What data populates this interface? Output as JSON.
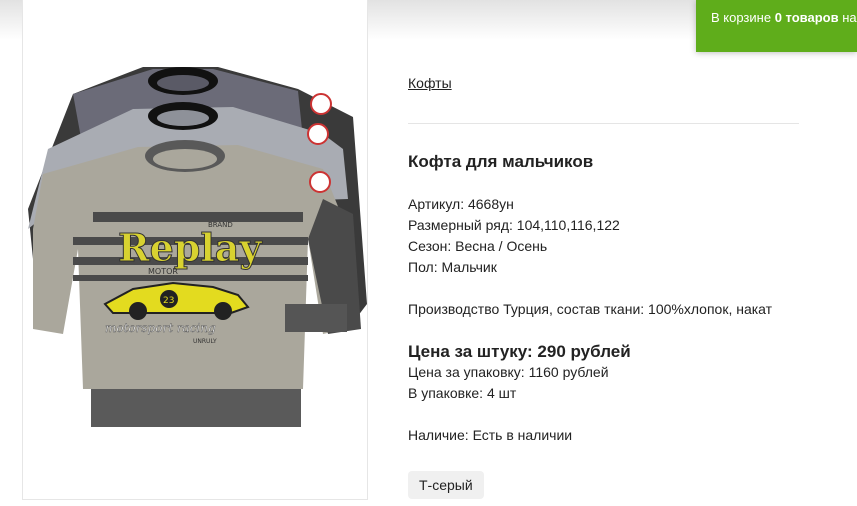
{
  "cart": {
    "prefix": "В корзине ",
    "count_text": "0 товаров",
    "suffix": " на"
  },
  "product": {
    "category_link": "Кофты",
    "title": "Кофта для мальчиков",
    "article": "Артикул: 4668ун",
    "sizes": "Размерный ряд: 104,110,116,122",
    "season": "Сезон: Весна / Осень",
    "gender": "Пол: Мальчик",
    "production": "Производство Турция, состав ткани: 100%хлопок, накат",
    "price_piece": "Цена за штуку: 290 рублей",
    "price_pack": "Цена за упаковку: 1160 рублей",
    "per_pack": "В упаковке: 4 шт",
    "availability": "Наличие: Есть в наличии",
    "color_option": "Т-серый"
  },
  "image": {
    "print_brand": "Replay",
    "print_small": "BRAND",
    "print_motor": "MOTOR",
    "print_number": "23",
    "print_slogan": "motorsport racing",
    "print_tag": "UNRULY"
  }
}
